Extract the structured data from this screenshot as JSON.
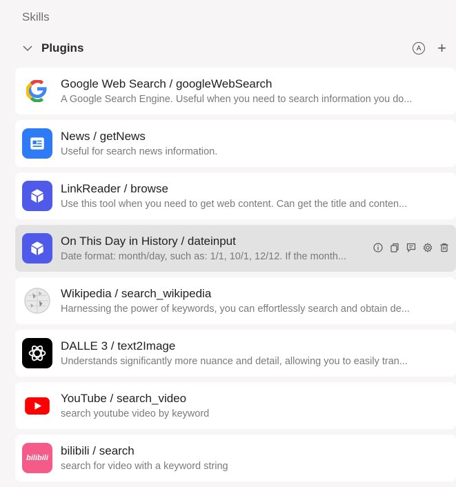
{
  "section": {
    "title": "Skills"
  },
  "group": {
    "title": "Plugins",
    "auto_icon_text": "A",
    "add_symbol": "+"
  },
  "plugins": [
    {
      "title": "Google Web Search / googleWebSearch",
      "desc": "A Google Search Engine. Useful when you need to search information you do...",
      "icon": "google-icon"
    },
    {
      "title": "News / getNews",
      "desc": "Useful for search news information.",
      "icon": "news-icon"
    },
    {
      "title": "LinkReader / browse",
      "desc": "Use this tool when you need to get web content. Can get the title and conten...",
      "icon": "box-icon"
    },
    {
      "title": "On This Day in History / dateinput",
      "desc": "Date format: month/day, such as: 1/1, 10/1, 12/12. If the month...",
      "icon": "box-icon"
    },
    {
      "title": "Wikipedia / search_wikipedia",
      "desc": "Harnessing the power of keywords, you can effortlessly search and obtain de...",
      "icon": "wikipedia-icon"
    },
    {
      "title": "DALLE 3 / text2Image",
      "desc": "Understands significantly more nuance and detail, allowing you to easily tran...",
      "icon": "openai-icon"
    },
    {
      "title": "YouTube / search_video",
      "desc": "search youtube video by keyword",
      "icon": "youtube-icon"
    },
    {
      "title": "bilibili / search",
      "desc": "search for video with a keyword string",
      "icon": "bilibili-icon",
      "logo_text": "bilibili"
    }
  ],
  "colors": {
    "active_row": "#e2e2e2",
    "news": "#2f7bf5",
    "box": "#4f5ae8",
    "youtube": "#ff0000",
    "bilibili": "#f45b89"
  }
}
